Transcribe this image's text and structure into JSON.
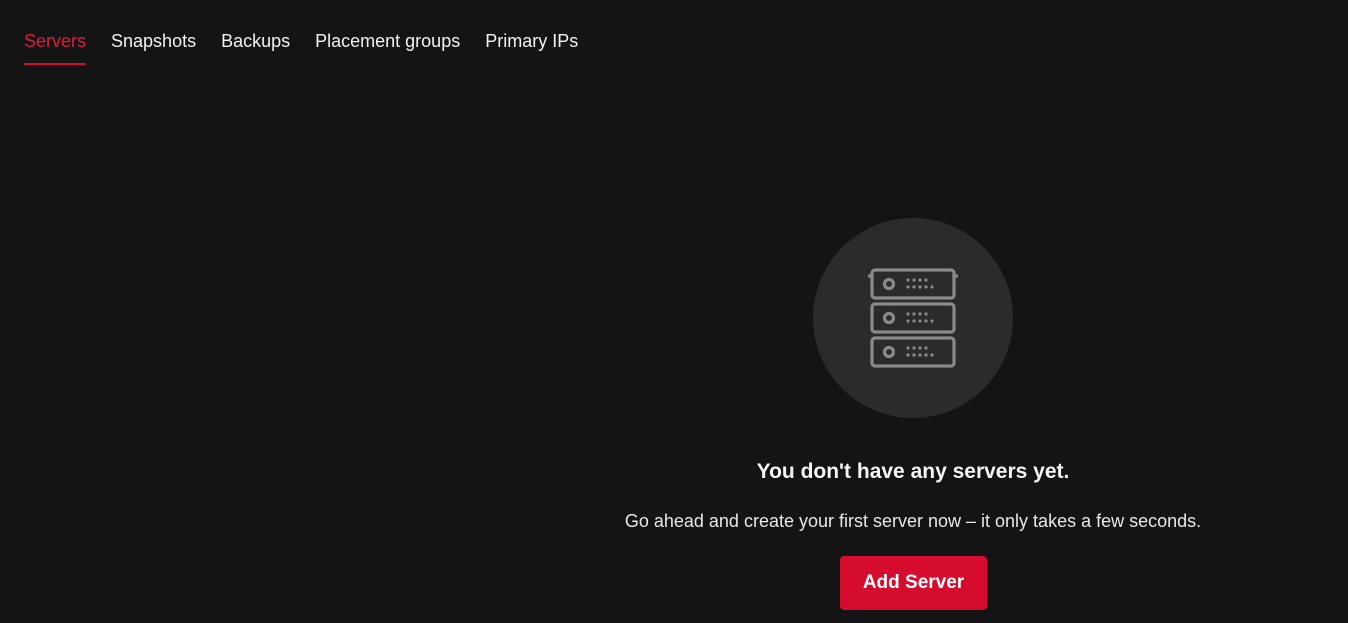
{
  "tabs": [
    {
      "label": "Servers",
      "active": true
    },
    {
      "label": "Snapshots",
      "active": false
    },
    {
      "label": "Backups",
      "active": false
    },
    {
      "label": "Placement groups",
      "active": false
    },
    {
      "label": "Primary IPs",
      "active": false
    }
  ],
  "empty_state": {
    "icon": "server-rack-icon",
    "title": "You don't have any servers yet.",
    "description": "Go ahead and create your first server now – it only takes a few seconds.",
    "button_label": "Add Server"
  },
  "colors": {
    "background": "#141414",
    "accent": "#d50c2d",
    "active_tab_text": "#e11d3f",
    "icon_circle": "#2b2b2b",
    "icon_stroke": "#8a8a8a"
  }
}
